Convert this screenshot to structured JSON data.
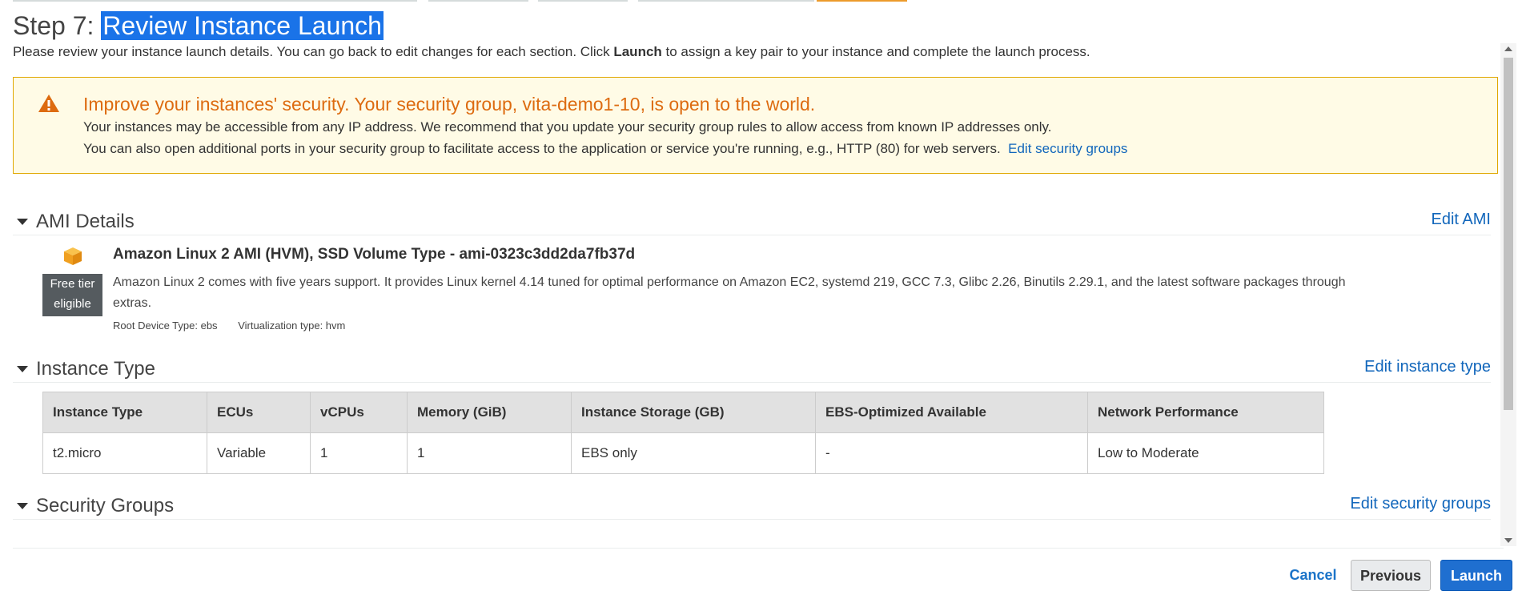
{
  "header": {
    "step_prefix": "Step 7: ",
    "step_title": "Review Instance Launch",
    "description_before": "Please review your instance launch details. You can go back to edit changes for each section. Click ",
    "description_bold": "Launch",
    "description_after": " to assign a key pair to your instance and complete the launch process."
  },
  "warning": {
    "icon": "warning-triangle-icon",
    "headline": "Improve your instances' security. Your security group, vita-demo1-10, is open to the world.",
    "line1": "Your instances may be accessible from any IP address. We recommend that you update your security group rules to allow access from known IP addresses only.",
    "line2": "You can also open additional ports in your security group to facilitate access to the application or service you're running, e.g., HTTP (80) for web servers.",
    "link": "Edit security groups"
  },
  "ami": {
    "section_title": "AMI Details",
    "edit_link": "Edit AMI",
    "icon": "cube-icon",
    "badge_line1": "Free tier",
    "badge_line2": "eligible",
    "name": "Amazon Linux 2 AMI (HVM), SSD Volume Type - ami-0323c3dd2da7fb37d",
    "description": "Amazon Linux 2 comes with five years support. It provides Linux kernel 4.14 tuned for optimal performance on Amazon EC2, systemd 219, GCC 7.3, Glibc 2.26, Binutils 2.29.1, and the latest software packages through extras.",
    "root_device": "Root Device Type: ebs",
    "virtualization": "Virtualization type: hvm"
  },
  "instance_type": {
    "section_title": "Instance Type",
    "edit_link": "Edit instance type",
    "columns": [
      "Instance Type",
      "ECUs",
      "vCPUs",
      "Memory (GiB)",
      "Instance Storage (GB)",
      "EBS-Optimized Available",
      "Network Performance"
    ],
    "row": [
      "t2.micro",
      "Variable",
      "1",
      "1",
      "EBS only",
      "-",
      "Low to Moderate"
    ]
  },
  "security_groups": {
    "section_title": "Security Groups",
    "edit_link": "Edit security groups"
  },
  "footer": {
    "cancel": "Cancel",
    "previous": "Previous",
    "launch": "Launch"
  },
  "colors": {
    "warning_text": "#dd6b10",
    "link": "#1166bb",
    "launch_button": "#1f6fd0",
    "progress_active": "#ec9b2b"
  }
}
